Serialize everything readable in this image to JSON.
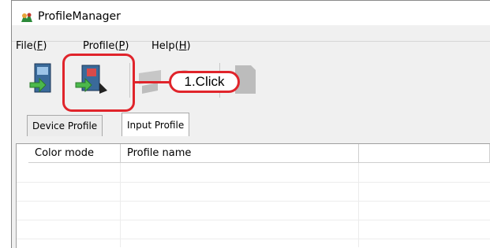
{
  "window": {
    "title": "ProfileManager"
  },
  "menu": {
    "items": [
      {
        "label": "File",
        "key": "F"
      },
      {
        "label": "Profile",
        "key": "P"
      },
      {
        "label": "Help",
        "key": "H"
      }
    ]
  },
  "toolbar": {
    "buttons": [
      {
        "icon": "device-profile-icon"
      },
      {
        "icon": "input-profile-icon"
      },
      {
        "icon": "disabled-link-icon"
      },
      {
        "icon": "disabled-tool-icon"
      },
      {
        "icon": "disabled-doc-icon"
      }
    ]
  },
  "tabs": [
    {
      "label": "Device Profile"
    },
    {
      "label": "Input Profile"
    }
  ],
  "table": {
    "columns": [
      "Color mode",
      "Profile name"
    ]
  },
  "annotation": {
    "label": "1.Click",
    "color": "#e0242b"
  }
}
